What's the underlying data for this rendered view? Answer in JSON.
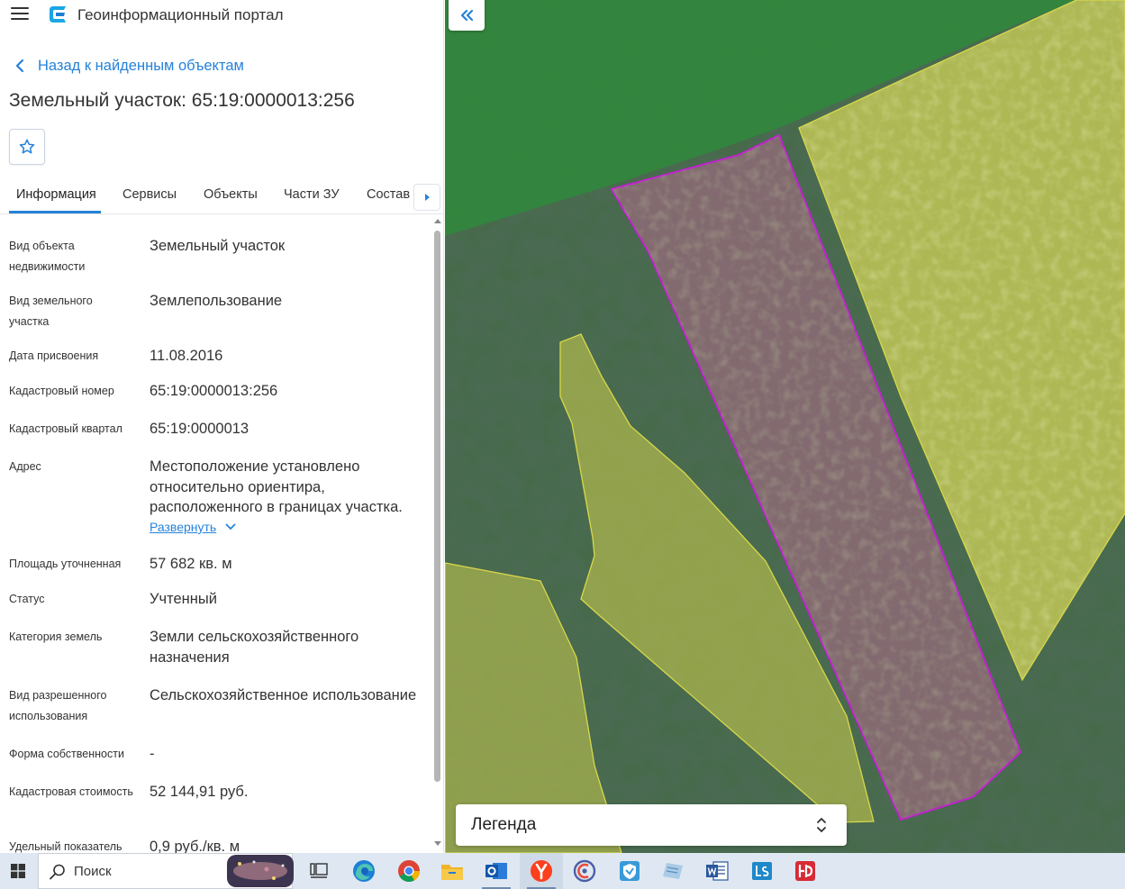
{
  "header": {
    "app_title": "Геоинформационный портал"
  },
  "back_link": "Назад к найденным объектам",
  "object_title": "Земельный участок: 65:19:0000013:256",
  "tabs": [
    {
      "label": "Информация",
      "active": true
    },
    {
      "label": "Сервисы",
      "active": false
    },
    {
      "label": "Объекты",
      "active": false
    },
    {
      "label": "Части ЗУ",
      "active": false
    },
    {
      "label": "Состав",
      "active": false
    }
  ],
  "attributes": [
    {
      "label": "Вид объекта недвижимости",
      "value": "Земельный участок"
    },
    {
      "label": "Вид земельного участка",
      "value": "Землепользование"
    },
    {
      "label": "Дата присвоения",
      "value": "11.08.2016"
    },
    {
      "label": "Кадастровый номер",
      "value": "65:19:0000013:256"
    },
    {
      "label": "Кадастровый квартал",
      "value": "65:19:0000013"
    },
    {
      "label": "Адрес",
      "value": "Местоположение установлено относительно ориентира, расположенного в границах участка.",
      "expand_label": "Развернуть"
    },
    {
      "label": "Площадь уточненная",
      "value": "57 682 кв. м"
    },
    {
      "label": "Статус",
      "value": "Учтенный"
    },
    {
      "label": "Категория земель",
      "value": "Земли сельскохозяйственного назначения"
    },
    {
      "label": "Вид разрешенного использования",
      "value": "Сельскохозяйственное использование"
    },
    {
      "label": "Форма собственности",
      "value": "-"
    },
    {
      "label": "Кадастровая стоимость",
      "value": "52 144,91 руб."
    },
    {
      "label": "Удельный показатель",
      "value": "0,9 руб./кв. м"
    }
  ],
  "map": {
    "legend_label": "Легенда",
    "selected_parcel_color": "#c21fd0",
    "neighbour_parcel_color": "#e6e64a"
  },
  "taskbar": {
    "search_placeholder": "Поиск",
    "apps": [
      "task-view",
      "edge",
      "chrome",
      "file-explorer",
      "outlook",
      "yandex-browser",
      "browser",
      "shield-app",
      "notes",
      "word",
      "ls-app",
      "app"
    ]
  },
  "colors": {
    "accent": "#2582d9",
    "text": "#333333"
  }
}
